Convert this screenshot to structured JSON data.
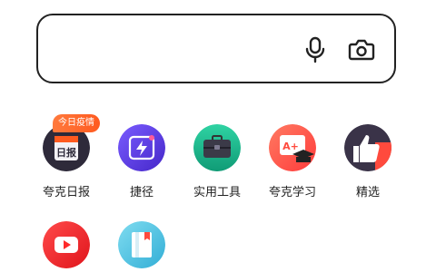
{
  "search": {
    "placeholder": ""
  },
  "icons": {
    "mic": "microphone-icon",
    "camera": "camera-icon"
  },
  "apps": [
    {
      "label": "夸克日报",
      "badge": "今日疫情",
      "icon_text": "日报"
    },
    {
      "label": "捷径"
    },
    {
      "label": "实用工具"
    },
    {
      "label": "夸克学习",
      "icon_text": "A+"
    },
    {
      "label": "精选"
    },
    {
      "label": ""
    },
    {
      "label": ""
    }
  ],
  "colors": {
    "border": "#222222",
    "badge": "#ff5a1f",
    "shortcut": "#5b3fe0",
    "tools": "#1fb38a",
    "study": "#ff5b4b",
    "picks": "#3a3348",
    "video": "#ff2a2a",
    "reader": "#5cc8e8"
  }
}
